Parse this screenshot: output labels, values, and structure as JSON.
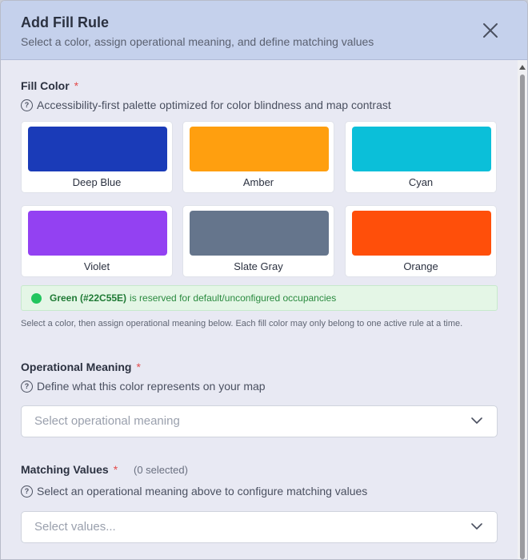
{
  "dialog": {
    "title": "Add Fill Rule",
    "subtitle": "Select a color, assign operational meaning, and define matching values"
  },
  "fill_color": {
    "label": "Fill Color",
    "required_mark": "*",
    "hint": "Accessibility-first palette optimized for color blindness and map contrast",
    "swatches": [
      {
        "name": "Deep Blue",
        "color": "#1a3bb8"
      },
      {
        "name": "Amber",
        "color": "#ff9f0f"
      },
      {
        "name": "Cyan",
        "color": "#0bbfd9"
      },
      {
        "name": "Violet",
        "color": "#9341f2"
      },
      {
        "name": "Slate Gray",
        "color": "#65758c"
      },
      {
        "name": "Orange",
        "color": "#ff4f0a"
      }
    ],
    "reserved_notice": {
      "bold": "Green (#22C55E)",
      "text": "is reserved for default/unconfigured occupancies",
      "color": "#22C55E"
    },
    "helper": "Select a color, then assign operational meaning below. Each fill color may only belong to one active rule at a time."
  },
  "operational_meaning": {
    "label": "Operational Meaning",
    "required_mark": "*",
    "hint": "Define what this color represents on your map",
    "placeholder": "Select operational meaning"
  },
  "matching_values": {
    "label": "Matching Values",
    "required_mark": "*",
    "count": "(0 selected)",
    "hint": "Select an operational meaning above to configure matching values",
    "placeholder": "Select values..."
  }
}
